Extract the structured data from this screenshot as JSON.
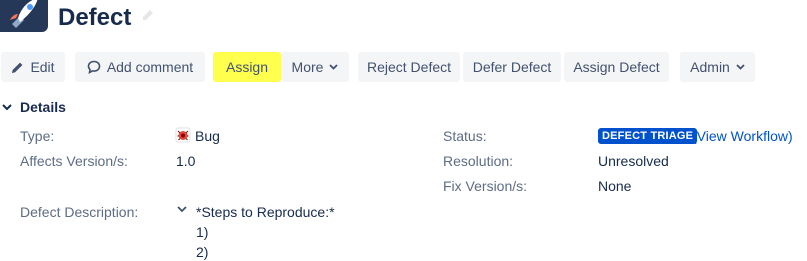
{
  "issue": {
    "title": "Defect"
  },
  "toolbar": {
    "edit": "Edit",
    "add_comment": "Add comment",
    "assign": "Assign",
    "more": "More",
    "reject": "Reject Defect",
    "defer": "Defer Defect",
    "assign_defect": "Assign Defect",
    "admin": "Admin"
  },
  "details": {
    "heading": "Details",
    "type_label": "Type:",
    "type_value": "Bug",
    "affects_label": "Affects Version/s:",
    "affects_value": "1.0",
    "status_label": "Status:",
    "status_value": "DEFECT TRIAGE",
    "view_workflow_open": "(",
    "view_workflow": "View Workflow",
    "view_workflow_close": ")",
    "resolution_label": "Resolution:",
    "resolution_value": "Unresolved",
    "fix_label": "Fix Version/s:",
    "fix_value": "None",
    "description_label": "Defect Description:",
    "description_lines": [
      "*Steps to Reproduce:*",
      "1)",
      "2)"
    ]
  },
  "colors": {
    "status_lozenge": "#0052cc",
    "assign_highlight": "#ffff4d",
    "link": "#0052cc"
  },
  "icons": [
    "project-avatar-rocket",
    "pencil-icon",
    "comment-icon",
    "chevron-down-icon",
    "bug-icon"
  ]
}
